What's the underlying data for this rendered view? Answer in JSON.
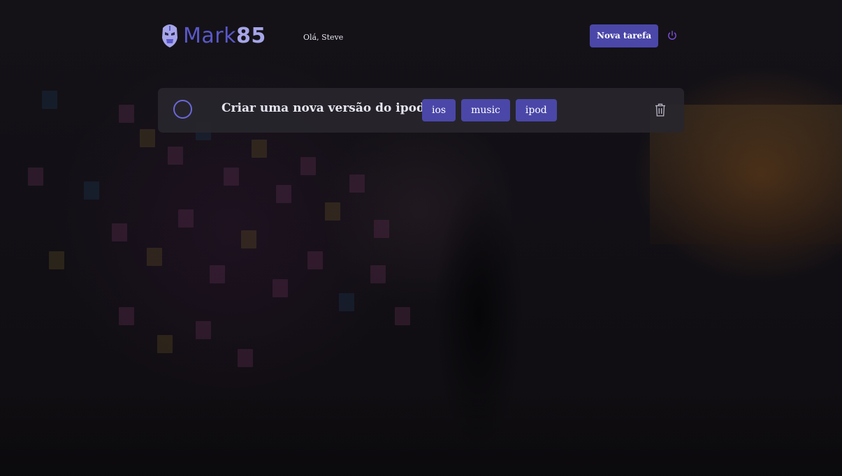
{
  "header": {
    "logo_text": "Mark",
    "logo_number": "85",
    "greeting": "Olá, Steve",
    "new_task_label": "Nova tarefa",
    "logo_icon": "ironman-helmet-icon",
    "logout_icon": "power-icon"
  },
  "tasks": [
    {
      "title": "Criar uma nova versão do ipod",
      "done": false,
      "tags": [
        "ios",
        "music",
        "ipod"
      ],
      "delete_icon": "trash-icon"
    }
  ],
  "colors": {
    "accent": "#4a47a8",
    "logo": "#5a58c9",
    "power": "#7b4fd6",
    "card": "#28262d"
  }
}
